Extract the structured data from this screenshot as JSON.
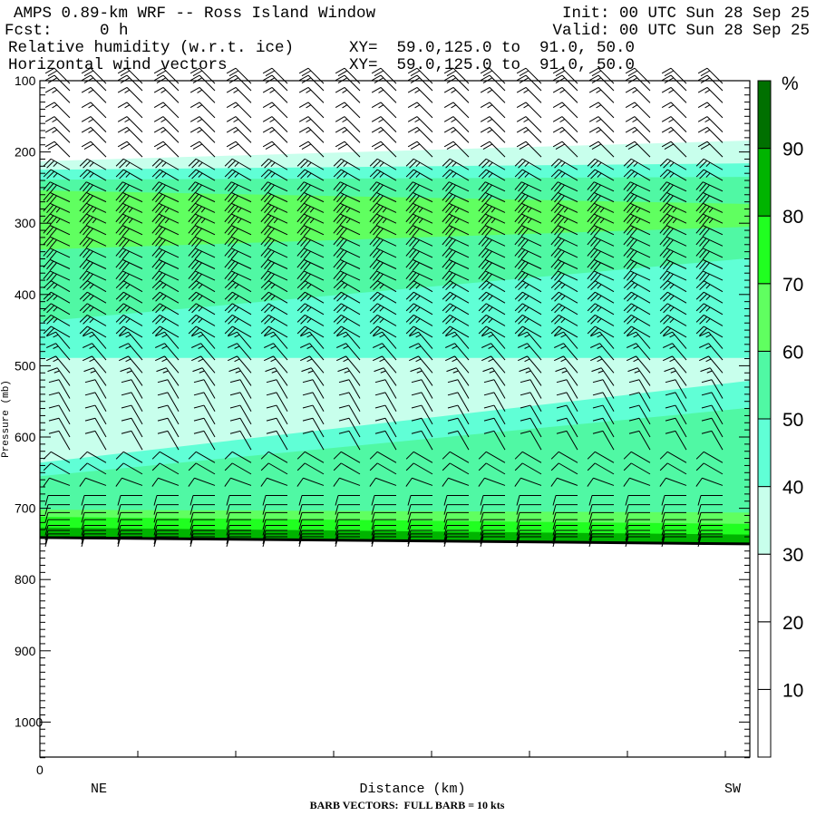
{
  "header": {
    "title": "AMPS 0.89-km WRF -- Ross Island Window",
    "fcst": "Fcst:     0 h",
    "init": "Init: 00 UTC Sun 28 Sep 25",
    "valid": "Valid: 00 UTC Sun 28 Sep 25",
    "field1": "Relative humidity (w.r.t. ice)",
    "field2": "Horizontal wind vectors",
    "xy1": "XY=  59.0,125.0 to  91.0, 50.0",
    "xy2": "XY=  59.0,125.0 to  91.0, 50.0"
  },
  "chart_data": {
    "type": "heatmap",
    "title": "Relative humidity (w.r.t. ice) and horizontal wind barbs cross-section",
    "y_axis": {
      "label": "Pressure (mb)",
      "range": [
        100,
        1050
      ],
      "reversed": true,
      "tick_labels": [
        "100",
        "200",
        "300",
        "400",
        "500",
        "600",
        "700",
        "800",
        "900",
        "1000"
      ],
      "tick_values": [
        100,
        200,
        300,
        400,
        500,
        600,
        700,
        800,
        900,
        1000
      ]
    },
    "x_axis": {
      "label": "Distance (km)",
      "start_label": "0",
      "left_label": "NE",
      "right_label": "SW"
    },
    "colorbar": {
      "unit": "%",
      "levels": [
        10,
        20,
        30,
        40,
        50,
        60,
        70,
        80,
        90
      ],
      "labels": [
        "10",
        "20",
        "30",
        "40",
        "50",
        "60",
        "70",
        "80",
        "90"
      ],
      "colors": [
        "#ffffff",
        "#ffffff",
        "#ffffff",
        "#c8ffec",
        "#60ffd6",
        "#50f8a4",
        "#60ff60",
        "#20ff20",
        "#00b400",
        "#007000"
      ]
    },
    "ground_pressure_mb": [
      741,
      750
    ],
    "rh_regions": [
      {
        "range": "30-40",
        "color_index": 3,
        "top_mb": [
          213,
          184
        ],
        "bottom_mb": "ground"
      },
      {
        "range": "40-50",
        "color_index": 4,
        "top_mb": [
          225,
          216
        ],
        "bottom_mb": [
          489,
          489
        ]
      },
      {
        "range": "50-60",
        "color_index": 5,
        "top_mb": [
          239,
          235
        ],
        "bottom_mb": [
          438,
          349
        ]
      },
      {
        "range": "60-70",
        "color_index": 6,
        "top_mb": [
          254,
          273
        ],
        "bottom_mb": [
          337,
          305
        ]
      },
      {
        "range": "40-50",
        "color_index": 4,
        "top_mb": [
          636,
          521
        ],
        "bottom_mb": "ground"
      },
      {
        "range": "50-60",
        "color_index": 5,
        "top_mb": [
          655,
          559
        ],
        "bottom_mb": "ground"
      },
      {
        "range": "60-70",
        "color_index": 6,
        "top_mb": [
          702,
          706
        ],
        "bottom_mb": "ground"
      },
      {
        "range": "70-80",
        "color_index": 7,
        "top_mb": [
          712,
          722
        ],
        "bottom_mb": "ground"
      },
      {
        "range": "80-90",
        "color_index": 8,
        "top_mb": [
          727,
          737
        ],
        "bottom_mb": "ground"
      }
    ],
    "wind_columns": 19,
    "wind_levels": [
      [
        104,
        315,
        20
      ],
      [
        114,
        315,
        20
      ],
      [
        131,
        315,
        15
      ],
      [
        152,
        315,
        15
      ],
      [
        172,
        315,
        15
      ],
      [
        187,
        315,
        15
      ],
      [
        207,
        315,
        20
      ],
      [
        225,
        300,
        25
      ],
      [
        240,
        300,
        25
      ],
      [
        255,
        295,
        30
      ],
      [
        270,
        295,
        30
      ],
      [
        285,
        295,
        35
      ],
      [
        300,
        295,
        35
      ],
      [
        316,
        295,
        30
      ],
      [
        332,
        295,
        30
      ],
      [
        348,
        295,
        30
      ],
      [
        364,
        295,
        30
      ],
      [
        380,
        295,
        30
      ],
      [
        396,
        300,
        25
      ],
      [
        412,
        300,
        25
      ],
      [
        428,
        300,
        25
      ],
      [
        444,
        300,
        25
      ],
      [
        460,
        300,
        20
      ],
      [
        476,
        320,
        15
      ],
      [
        492,
        320,
        15
      ],
      [
        510,
        320,
        15
      ],
      [
        528,
        325,
        15
      ],
      [
        546,
        330,
        10
      ],
      [
        564,
        330,
        10
      ],
      [
        582,
        330,
        10
      ],
      [
        600,
        330,
        10
      ],
      [
        618,
        330,
        10
      ],
      [
        636,
        300,
        10
      ],
      [
        652,
        300,
        10
      ],
      [
        668,
        290,
        10
      ],
      [
        682,
        270,
        10
      ],
      [
        695,
        270,
        10
      ],
      [
        706,
        270,
        10
      ],
      [
        716,
        270,
        10
      ],
      [
        724,
        270,
        10
      ],
      [
        731,
        270,
        10
      ],
      [
        736,
        270,
        10
      ],
      [
        740,
        270,
        10
      ]
    ],
    "barb_note": "BARB VECTORS:  FULL BARB = 10 kts"
  }
}
